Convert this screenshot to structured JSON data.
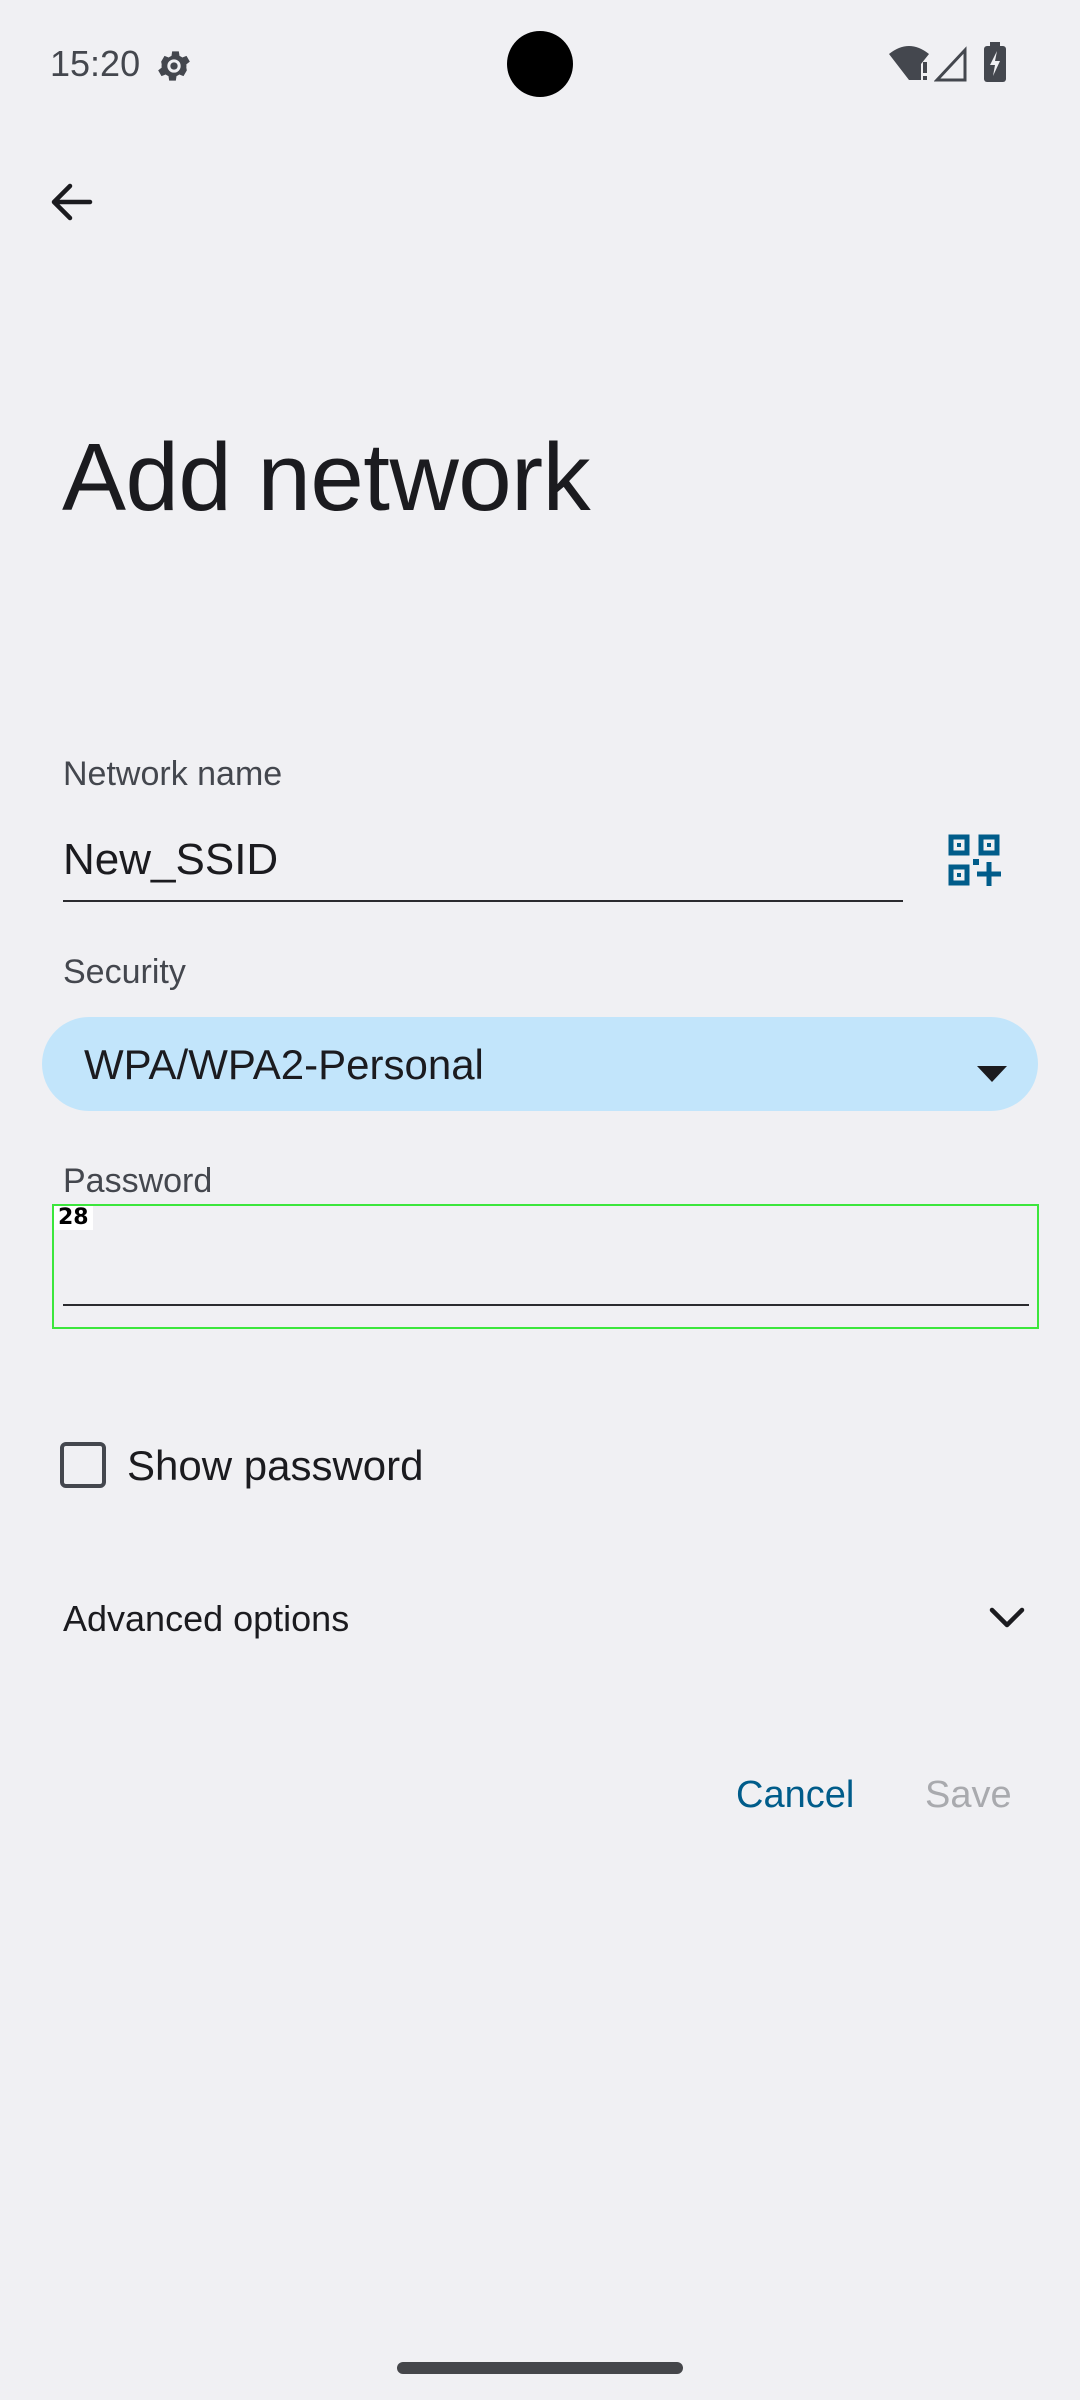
{
  "status_bar": {
    "time": "15:20"
  },
  "page": {
    "title": "Add network"
  },
  "network": {
    "label": "Network name",
    "value": "New_SSID"
  },
  "security": {
    "label": "Security",
    "value": "WPA/WPA2-Personal"
  },
  "password": {
    "label": "Password",
    "value": ""
  },
  "focus_marker": {
    "index": "28"
  },
  "show_password": {
    "label": "Show password",
    "checked": false
  },
  "advanced": {
    "label": "Advanced options"
  },
  "actions": {
    "cancel": "Cancel",
    "save": "Save"
  },
  "colors": {
    "background": "#f0f0f3",
    "accent": "#005c8a",
    "dropdown_fill": "#c2e5fb",
    "focus_outline": "#3ce63c",
    "disabled_text": "#a9aaae"
  },
  "icons": {
    "status_settings": "settings-gear-icon",
    "wifi": "wifi-alert-icon",
    "signal": "cell-signal-icon",
    "battery": "battery-charging-icon",
    "back": "back-arrow-icon",
    "qr": "qr-code-scan-icon",
    "dropdown": "dropdown-caret-icon",
    "expand": "chevron-down-icon"
  }
}
